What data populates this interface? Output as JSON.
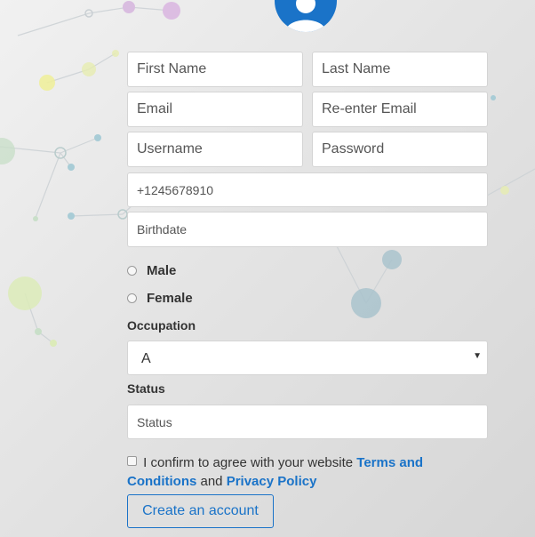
{
  "form": {
    "first_name_placeholder": "First Name",
    "last_name_placeholder": "Last Name",
    "email_placeholder": "Email",
    "reenter_email_placeholder": "Re-enter Email",
    "username_placeholder": "Username",
    "password_placeholder": "Password",
    "phone_placeholder": "+1245678910",
    "birthdate_placeholder": "Birthdate",
    "gender_options": [
      "Male",
      "Female"
    ],
    "occupation_label": "Occupation",
    "occupation_value": "A",
    "status_label": "Status",
    "status_placeholder": "Status",
    "agree_text": "I confirm to agree with your website",
    "terms_link": "Terms and Conditions",
    "and_text": "and",
    "privacy_link": "Privacy Policy",
    "submit_label": "Create an account"
  },
  "icons": {
    "avatar": "user-icon",
    "select_caret": "caret-down-icon"
  },
  "colors": {
    "accent": "#1a73c8",
    "field_border": "#d4d4d4",
    "text": "#333333"
  }
}
